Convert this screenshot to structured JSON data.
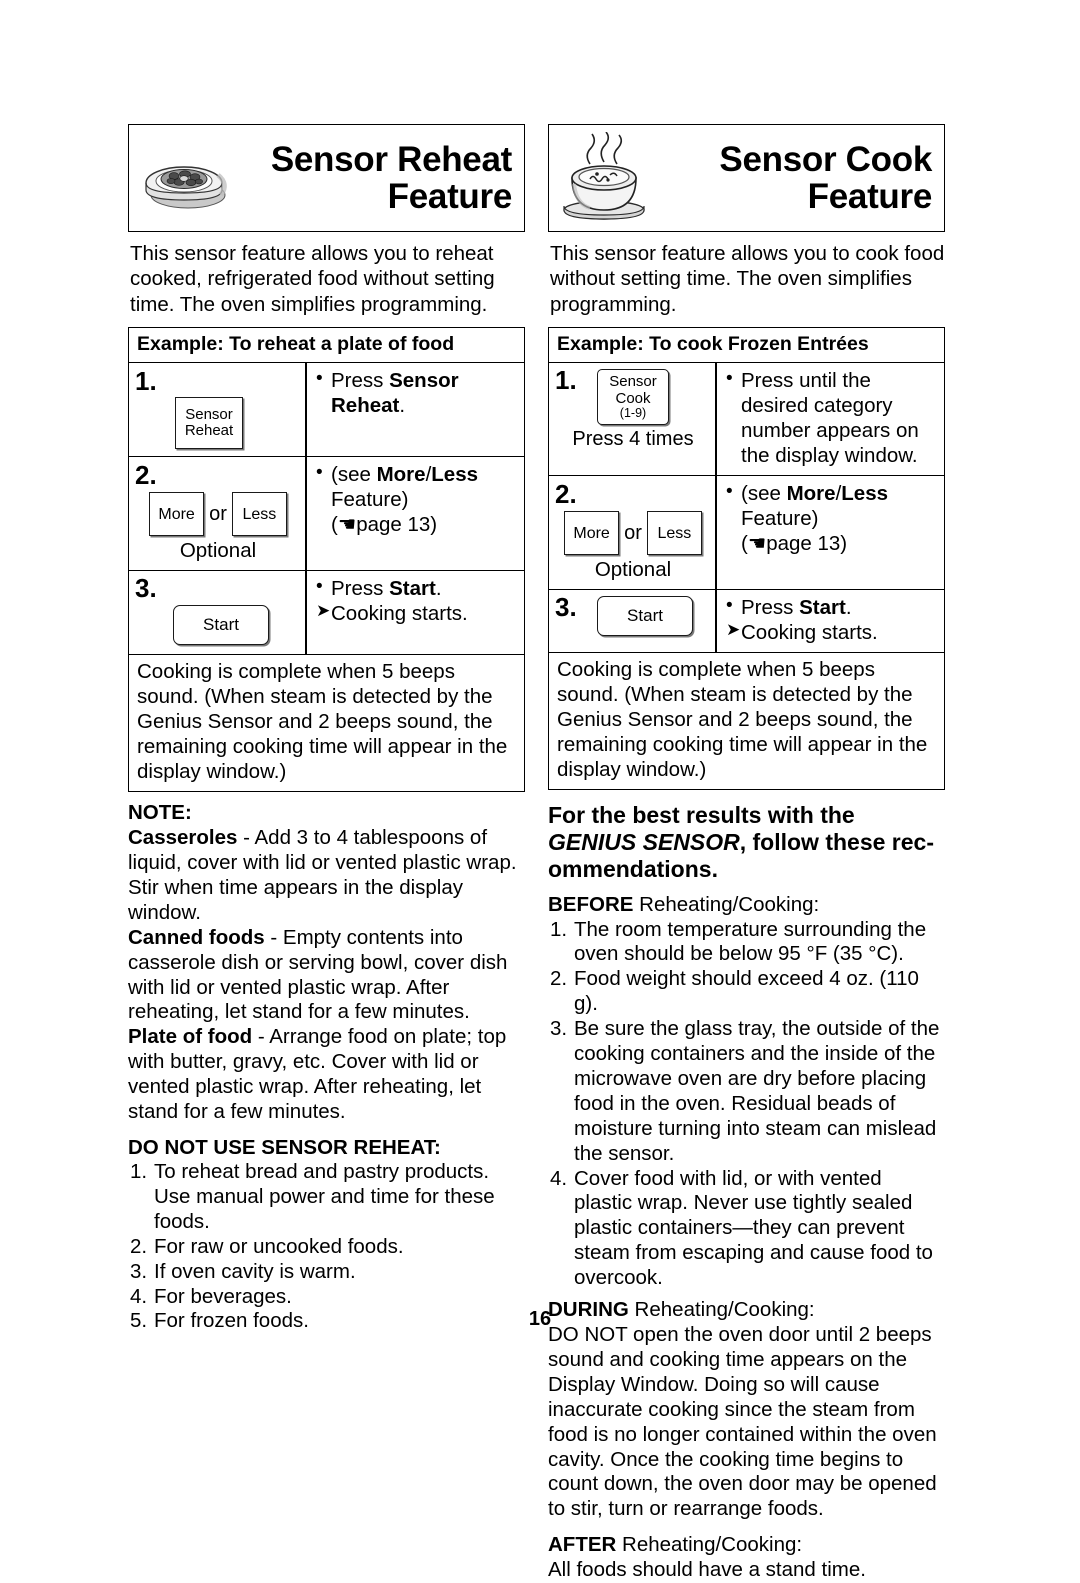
{
  "page": {
    "number": "16"
  },
  "left_column": {
    "banner": {
      "title_line1": "Sensor Reheat",
      "title_line2": "Feature",
      "icon": "plate-of-food-icon"
    },
    "intro": "This sensor feature allows you to reheat cooked, refrigerated food without setting time. The oven simplifies programming.",
    "example_bar": "Example: To reheat a plate of food",
    "steps": [
      {
        "number": "1.",
        "button_label_line1": "Sensor",
        "button_label_line2": "Reheat",
        "instruction_bullet": "Press ",
        "instruction_bold": "Sensor Reheat",
        "instruction_tail": "."
      },
      {
        "number": "2.",
        "button_more": "More",
        "or_word": "or",
        "button_less": "Less",
        "optional": "Optional",
        "line1_pre": "(see ",
        "line1_bold": "More",
        "line1_mid": "/",
        "line1_bold2": "Less",
        "line2": "Feature)",
        "line3": "(☚page 13)"
      },
      {
        "number": "3.",
        "button_start": "Start",
        "line1_pre": "Press ",
        "line1_bold": "Start",
        "line1_tail": ".",
        "line2": "Cooking starts."
      }
    ],
    "complete_box": "Cooking is complete when 5 beeps sound. (When steam is detected by the Genius Sensor and 2 beeps sound, the remaining cooking time will appear in the display window.)",
    "note_heading": "NOTE:",
    "notes": [
      {
        "term": "Casseroles",
        "text": " - Add 3 to 4 tablespoons of liquid, cover with lid or vented plastic wrap. Stir when time appears in the display window."
      },
      {
        "term": "Canned foods",
        "text": " - Empty contents into casserole dish or serving bowl, cover dish with lid or vented plastic wrap. After reheating, let stand for a few minutes."
      },
      {
        "term": "Plate of food",
        "text": " - Arrange food on plate; top with butter, gravy, etc. Cover with lid or vented plastic wrap. After reheating, let stand for a few minutes."
      }
    ],
    "do_not_use_heading": "DO NOT USE SENSOR REHEAT:",
    "do_not_use_items": [
      {
        "n": "1.",
        "text": "To reheat bread and pastry products. Use manual power and time for these foods."
      },
      {
        "n": "2.",
        "text": "For raw or uncooked foods."
      },
      {
        "n": "3.",
        "text": "If oven cavity is warm."
      },
      {
        "n": "4.",
        "text": "For beverages."
      },
      {
        "n": "5.",
        "text": "For frozen foods."
      }
    ]
  },
  "right_column": {
    "banner": {
      "title_line1": "Sensor Cook",
      "title_line2": "Feature",
      "icon": "steaming-bowl-icon"
    },
    "intro": "This sensor feature allows you to cook food without setting time. The oven simplifies programming.",
    "example_bar": "Example: To cook Frozen Entrées",
    "steps": [
      {
        "number": "1.",
        "button_label_line1": "Sensor",
        "button_label_line2": "Cook",
        "button_label_line3": "(1-9)",
        "press_times": "Press 4 times",
        "instruction": "Press until the desired category number appears on the display window."
      },
      {
        "number": "2.",
        "button_more": "More",
        "or_word": "or",
        "button_less": "Less",
        "optional": "Optional",
        "line1_pre": "(see ",
        "line1_bold": "More",
        "line1_mid": "/",
        "line1_bold2": "Less",
        "line2": "Feature)",
        "line3": "(☚page 13)"
      },
      {
        "number": "3.",
        "button_start": "Start",
        "line1_pre": "Press ",
        "line1_bold": "Start",
        "line1_tail": ".",
        "line2": "Cooking starts."
      }
    ],
    "complete_box": "Cooking is complete when 5 beeps sound. (When steam is detected by the Genius Sensor and 2 beeps sound, the remaining cooking time will appear in the display window.)",
    "section_title_line1": "For the best results with the",
    "section_title_genius": "GENIUS SENSOR",
    "section_title_rest": ", follow these rec-",
    "section_title_line3": "ommendations.",
    "before_label": "BEFORE",
    "before_tail": " Reheating/Cooking:",
    "before_items": [
      {
        "n": "1.",
        "text": "The room temperature surrounding the oven should be below 95 °F (35 °C)."
      },
      {
        "n": "2.",
        "text": "Food weight should exceed 4 oz. (110 g)."
      },
      {
        "n": "3.",
        "text": "Be sure the glass tray, the outside of the cooking containers and the inside of the microwave oven are dry before placing food in the oven. Residual beads of moisture turning into steam can mislead the sensor."
      },
      {
        "n": "4.",
        "text": "Cover food with lid, or with vented plastic wrap. Never use tightly sealed plastic containers—they can prevent steam from escaping and cause food to overcook."
      }
    ],
    "during_label": "DURING",
    "during_tail": " Reheating/Cooking:",
    "during_text": "DO NOT open the oven door until 2 beeps sound and cooking time appears on the Display Window.  Doing so will cause inaccurate cooking since the steam from food is no longer contained within the oven cavity. Once the cooking time begins to count down, the oven door may be opened to stir, turn or rearrange foods.",
    "after_label": "AFTER",
    "after_tail": " Reheating/Cooking:",
    "after_text": "All foods should have a stand time."
  }
}
